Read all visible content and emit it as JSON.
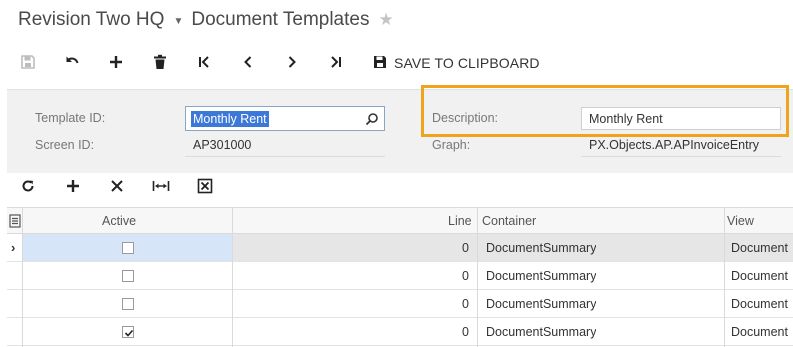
{
  "header": {
    "company": "Revision Two HQ",
    "page_title": "Document Templates"
  },
  "toolbar": {
    "save_to_clipboard": "SAVE TO CLIPBOARD"
  },
  "form": {
    "template_id_label": "Template ID:",
    "template_id_value": "Monthly Rent",
    "screen_id_label": "Screen ID:",
    "screen_id_value": "AP301000",
    "description_label": "Description:",
    "description_value": "Monthly Rent",
    "graph_label": "Graph:",
    "graph_value": "PX.Objects.AP.APInvoiceEntry"
  },
  "grid": {
    "columns": {
      "active": "Active",
      "line": "Line",
      "container": "Container",
      "view": "View"
    },
    "rows": [
      {
        "active": false,
        "line": "0",
        "container": "DocumentSummary",
        "view": "Document",
        "selected": true
      },
      {
        "active": false,
        "line": "0",
        "container": "DocumentSummary",
        "view": "Document",
        "selected": false
      },
      {
        "active": false,
        "line": "0",
        "container": "DocumentSummary",
        "view": "Document",
        "selected": false
      },
      {
        "active": true,
        "line": "0",
        "container": "DocumentSummary",
        "view": "Document",
        "selected": false
      }
    ]
  },
  "colors": {
    "highlight": "#f0a31c",
    "selection": "#3c78d8",
    "selected_row": "#d6e6f8"
  }
}
